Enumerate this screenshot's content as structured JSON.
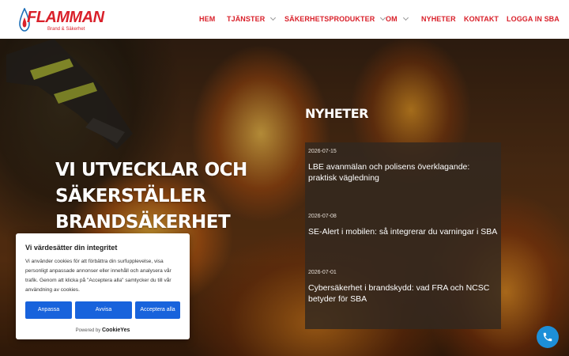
{
  "header": {
    "logo": {
      "brand": "FLAMMAN",
      "tagline": "Brand & Säkerhet"
    },
    "nav": [
      {
        "label": "HEM",
        "has_dropdown": false
      },
      {
        "label": "TJÄNSTER",
        "has_dropdown": true
      },
      {
        "label": "SÄKERHETSPRODUKTER",
        "has_dropdown": true
      },
      {
        "label": "OM",
        "has_dropdown": true
      },
      {
        "label": "NYHETER",
        "has_dropdown": false
      },
      {
        "label": "KONTAKT",
        "has_dropdown": false
      },
      {
        "label": "LOGGA IN SBA",
        "has_dropdown": false
      }
    ]
  },
  "hero": {
    "title_lines": [
      "VI UTVECKLAR OCH",
      "SÄKERSTÄLLER",
      "BRANDSÄKERHET"
    ]
  },
  "news": {
    "heading": "NYHETER",
    "items": [
      {
        "date": "2026-07-15",
        "title": "LBE avanmälan och polisens överklagande: praktisk vägledning"
      },
      {
        "date": "2026-07-08",
        "title": "SE-Alert i mobilen: så integrerar du varningar i SBA"
      },
      {
        "date": "2026-07-01",
        "title": "Cybersäkerhet i brandskydd: vad FRA och NCSC betyder för SBA"
      }
    ]
  },
  "cookie": {
    "title": "Vi värdesätter din integritet",
    "text": "Vi använder cookies för att förbättra din surfupplevelse, visa personligt anpassade annonser eller innehåll och analysera vår trafik. Genom att klicka på \"Acceptera alla\" samtycker du till vår användning av cookies.",
    "buttons": {
      "customize": "Anpassa",
      "reject": "Avvisa",
      "accept": "Acceptera alla"
    },
    "powered_by": "Powered by",
    "powered_brand": "CookieYes"
  },
  "icons": {
    "phone": "phone-icon",
    "logo_drop": "flame-drop-icon",
    "chevron": "chevron-down-icon"
  },
  "colors": {
    "brand_red": "#d9202a",
    "cookie_button": "#1863dc",
    "phone_button": "#1d8fd8"
  }
}
